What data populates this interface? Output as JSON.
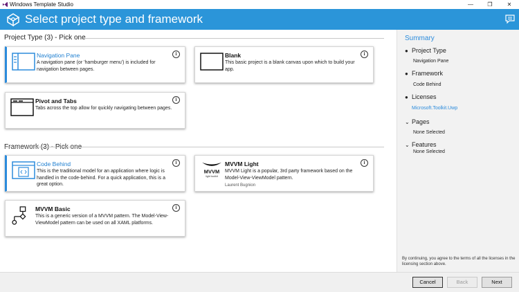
{
  "window": {
    "title": "Windows Template Studio",
    "controls": [
      "—",
      "❐",
      "✕"
    ]
  },
  "header": {
    "title": "Select project type and framework",
    "accent": "#2b95d9"
  },
  "project_type": {
    "heading": "Project Type (3) - Pick one",
    "cards": [
      {
        "name": "Navigation Pane",
        "desc": "A navigation pane (or 'hamburger menu') is included for navigation between pages.",
        "selected": true,
        "icon": "navigation-pane-icon"
      },
      {
        "name": "Blank",
        "desc": "This basic project is a blank canvas upon which to build your app.",
        "selected": false,
        "icon": "blank-icon"
      },
      {
        "name": "Pivot and Tabs",
        "desc": "Tabs across the top allow for quickly navigating between pages.",
        "selected": false,
        "icon": "pivot-tabs-icon"
      }
    ]
  },
  "framework": {
    "heading": "Framework (3) - Pick one",
    "cards": [
      {
        "name": "Code Behind",
        "desc": "This is the traditional model for an application where logic is handled in the code-behind.  For a quick application, this is a great option.",
        "selected": true,
        "icon": "code-behind-icon"
      },
      {
        "name": "MVVM Light",
        "desc": "MVVM Light is a popular, 3rd party framework based on the Model-View-ViewModel pattern.",
        "author": "Laurent Bugnion",
        "selected": false,
        "icon": "mvvm-light-logo",
        "logo_text": "MVVM",
        "logo_sub": "light toolkit"
      },
      {
        "name": "MVVM Basic",
        "desc": "This is a generic version of a MVVM pattern. The Model-View-ViewModel pattern can be used on all XAML platforms.",
        "selected": false,
        "icon": "mvvm-basic-icon"
      }
    ]
  },
  "summary": {
    "title": "Summary",
    "sections": [
      {
        "label": "Project Type",
        "mark": "●",
        "value": "Navigation Pane"
      },
      {
        "label": "Framework",
        "mark": "●",
        "value": "Code Behind"
      },
      {
        "label": "Licenses",
        "mark": "●",
        "value": "Microsoft.Toolkit.Uwp"
      },
      {
        "label": "Pages",
        "mark": "⌄",
        "value": "None Selected"
      },
      {
        "label": "Features",
        "mark": "⌄",
        "value": "None Selected"
      }
    ],
    "note": "By continuing, you agree to the terms of all the licenses in the licensing section above."
  },
  "footer": {
    "cancel": "Cancel",
    "back": "Back",
    "next": "Next"
  },
  "info_glyph": "i"
}
